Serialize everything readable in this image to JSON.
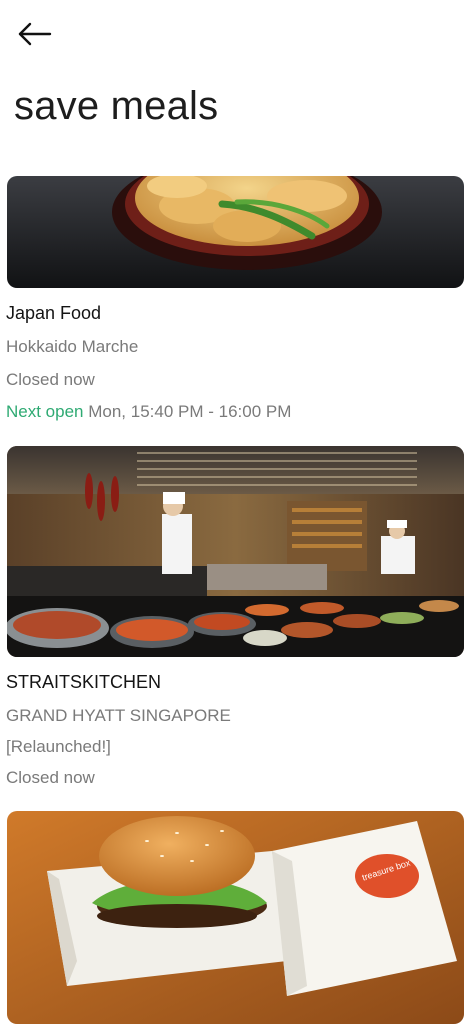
{
  "header": {
    "back_icon": "arrow-left-icon",
    "title": "save meals"
  },
  "colors": {
    "accent_green": "#2faa73",
    "text_primary": "#141414",
    "text_secondary": "#7a7a7a"
  },
  "cards": [
    {
      "image": "tempura-bowl-photo",
      "name": "Japan Food",
      "location": "Hokkaido Marche",
      "status": "Closed now",
      "next_open_label": "Next open",
      "next_open_time": "Mon, 15:40 PM - 16:00 PM"
    },
    {
      "image": "buffet-kitchen-photo",
      "name": "STRAITSKITCHEN",
      "location": "GRAND HYATT SINGAPORE",
      "note": "[Relaunched!]",
      "status": "Closed now"
    },
    {
      "image": "burger-takeaway-box-photo",
      "box_text": "treasure box"
    }
  ]
}
